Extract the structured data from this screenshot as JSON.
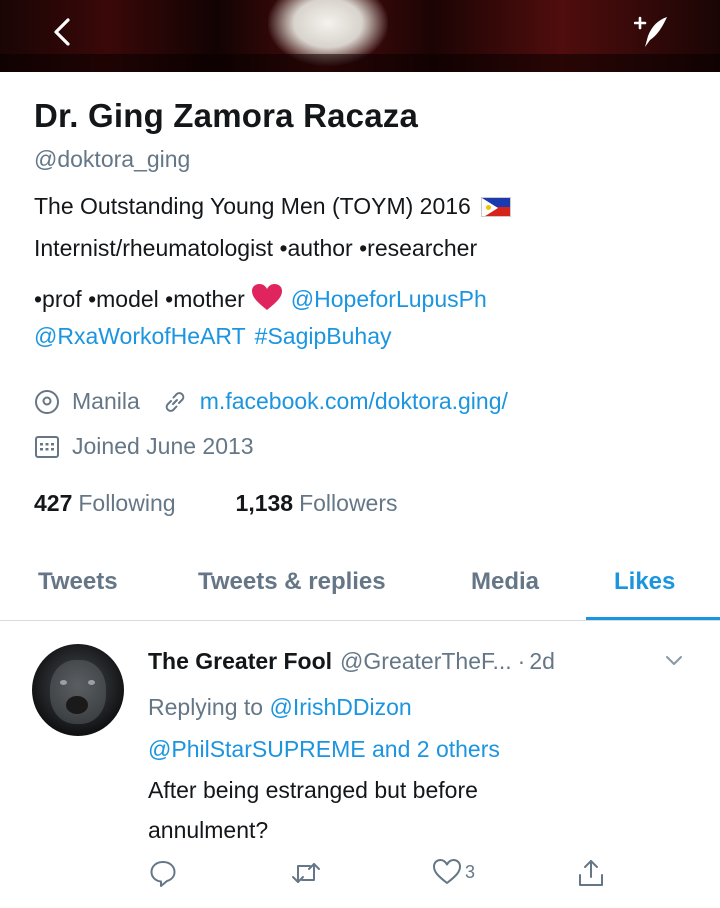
{
  "header": {
    "back_icon": "chevron-left-icon",
    "compose_icon": "compose-tweet-icon"
  },
  "profile": {
    "display_name": "Dr. Ging Zamora Racaza",
    "handle": "@doktora_ging",
    "bio": {
      "line1": "The Outstanding Young Men (TOYM) 2016",
      "line1_emoji": "philippines-flag",
      "line2": "Internist/rheumatologist •author •researcher",
      "line3_text": "•prof •model •mother",
      "line3_emoji": "red-heart",
      "line3_link": "@HopeforLupusPh",
      "line4_link1": "@RxaWorkofHeART",
      "line4_link2": "#SagipBuhay"
    },
    "location": "Manila",
    "website": "m.facebook.com/doktora.ging/",
    "joined": "Joined June 2013",
    "following_count": "427",
    "following_label": "Following",
    "followers_count": "1,138",
    "followers_label": "Followers"
  },
  "tabs": [
    {
      "label": "Tweets",
      "active": false
    },
    {
      "label": "Tweets & replies",
      "active": false
    },
    {
      "label": "Media",
      "active": false
    },
    {
      "label": "Likes",
      "active": true
    }
  ],
  "tweet": {
    "author_name": "The Greater Fool",
    "author_handle": "@GreaterTheF...",
    "separator": "·",
    "time": "2d",
    "replying_prefix": "Replying to",
    "replying_to1": "@IrishDDizon",
    "replying_to2": "@PhilStarSUPREME",
    "replying_suffix": "and 2 others",
    "text_line1": "After being estranged but before",
    "text_line2": "annulment?",
    "like_count": "3"
  },
  "colors": {
    "accent": "#1b95e0",
    "secondary_text": "#657786",
    "primary_text": "#14171a",
    "heart": "#e0245e"
  }
}
